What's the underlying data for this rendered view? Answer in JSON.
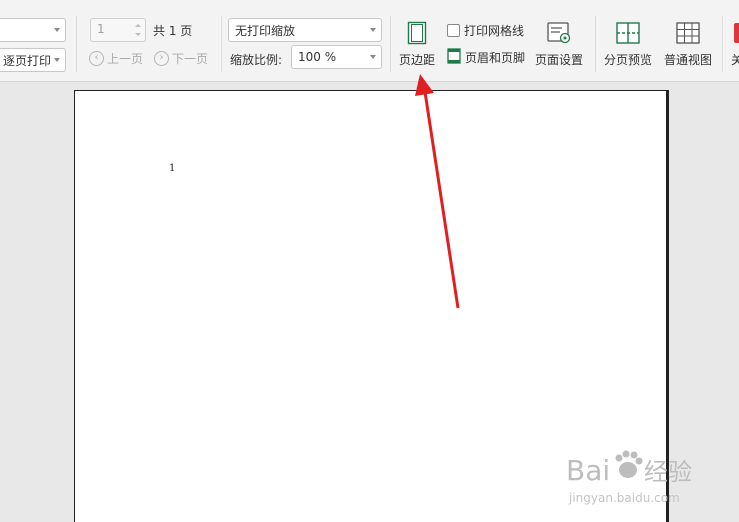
{
  "toolbar": {
    "top_dropdown_value": "",
    "print_order": "逐页打印",
    "page_input": "1",
    "total_pages": "共 1 页",
    "prev_page": "上一页",
    "next_page": "下一页",
    "scale_mode": "无打印缩放",
    "scale_ratio_label": "缩放比例:",
    "scale_ratio_value": "100 %",
    "margins": "页边距",
    "print_gridlines": "打印网格线",
    "header_footer": "页眉和页脚",
    "page_setup": "页面设置",
    "page_break_preview": "分页预览",
    "normal_view": "普通视图",
    "close_partial": "关"
  },
  "document": {
    "page_number": "1"
  },
  "watermark": {
    "brand": "Bai",
    "brand2": "经验",
    "url": "jingyan.baidu.com"
  },
  "colors": {
    "arrow": "#e02020",
    "close_accent": "#d9363e"
  },
  "icons": [
    "chevron-left-icon",
    "chevron-right-icon",
    "margins-icon",
    "checkbox-icon",
    "header-footer-icon",
    "page-setup-icon",
    "page-break-preview-icon",
    "normal-view-icon",
    "paw-icon"
  ]
}
